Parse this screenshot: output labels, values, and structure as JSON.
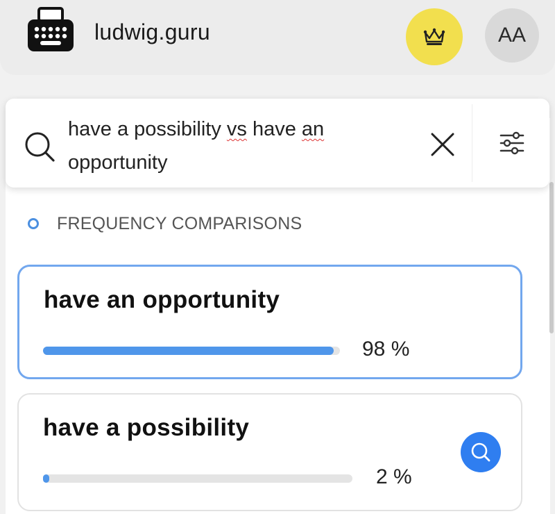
{
  "header": {
    "site_name": "ludwig.guru",
    "logo_icon": "typewriter-icon",
    "premium_icon": "crown-icon",
    "text_size_label": "AA"
  },
  "search": {
    "query_part1": "have a possibility ",
    "query_vs": "vs",
    "query_part2": " have ",
    "query_an": "an",
    "query_part3": " opportunity",
    "search_icon": "search-icon",
    "clear_icon": "close-icon",
    "filter_icon": "filter-sliders-icon"
  },
  "frequency": {
    "section_title": "FREQUENCY COMPARISONS",
    "items": [
      {
        "phrase": "have an opportunity",
        "percent": 98,
        "percent_label": "98 %"
      },
      {
        "phrase": "have a possibility",
        "percent": 2,
        "percent_label": "2 %"
      }
    ]
  },
  "colors": {
    "accent": "#4f96ea",
    "premium": "#f2df4e",
    "search_button": "#2f7ef0"
  }
}
